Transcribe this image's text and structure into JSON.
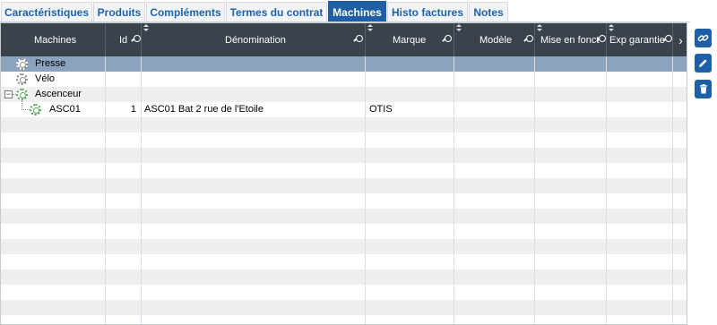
{
  "tabs": [
    {
      "label": "Caractéristiques"
    },
    {
      "label": "Produits"
    },
    {
      "label": "Compléments"
    },
    {
      "label": "Termes du contrat"
    },
    {
      "label": "Machines"
    },
    {
      "label": "Histo factures"
    },
    {
      "label": "Notes"
    }
  ],
  "active_tab": "Machines",
  "grid": {
    "columns": [
      {
        "label": "Machines"
      },
      {
        "label": "Id"
      },
      {
        "label": "Dénomination"
      },
      {
        "label": "Marque"
      },
      {
        "label": "Modèle"
      },
      {
        "label": "Mise en fonct"
      },
      {
        "label": "Exp garantie"
      }
    ],
    "rows": [
      {
        "machine": "Presse",
        "id": "",
        "denomination": "",
        "marque": "",
        "selected": true
      },
      {
        "machine": "Vélo",
        "id": "",
        "denomination": "",
        "marque": ""
      },
      {
        "machine": "Ascenceur",
        "id": "",
        "denomination": "",
        "marque": "",
        "expanded": true
      },
      {
        "machine": "ASC01",
        "id": "1",
        "denomination": "ASC01 Bat 2 rue de l'Etoile",
        "marque": "OTIS"
      }
    ]
  },
  "side_actions": [
    {
      "name": "link",
      "icon": "link-icon"
    },
    {
      "name": "edit",
      "icon": "pencil-icon"
    },
    {
      "name": "delete",
      "icon": "trash-icon"
    }
  ],
  "colors": {
    "accent": "#1f5fa8",
    "header_bg": "#3a434c",
    "selected_row": "#8ba3bd"
  }
}
